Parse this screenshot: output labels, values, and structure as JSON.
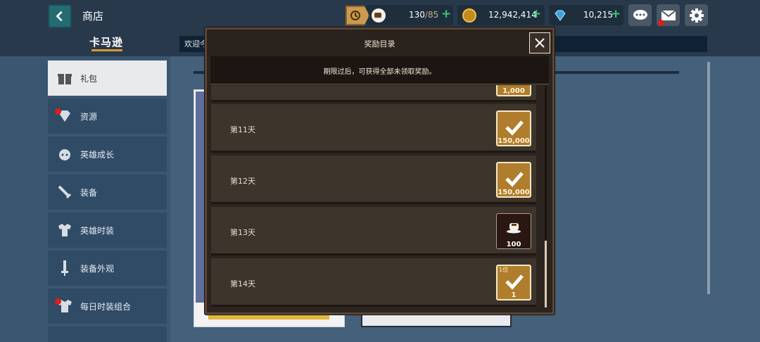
{
  "header": {
    "title": "商店",
    "brand": "卡马逊",
    "welcome": "欢迎今"
  },
  "resources": {
    "stamina": "130",
    "stamina_max": "/85",
    "gold": "12,942,414",
    "gems": "10,215"
  },
  "colors": {
    "accent_green": "#3cc67a",
    "gold_brown": "#b07d2c",
    "alert_red": "#e01c1c"
  },
  "sidebar": {
    "items": [
      {
        "label": "礼包",
        "icon": "gift-icon",
        "active": true
      },
      {
        "label": "资源",
        "icon": "diamond-icon",
        "badge": true
      },
      {
        "label": "英雄成长",
        "icon": "hero-growth-icon"
      },
      {
        "label": "装备",
        "icon": "sword-icon"
      },
      {
        "label": "英雄时装",
        "icon": "costume-icon"
      },
      {
        "label": "装备外观",
        "icon": "equipment-skin-icon"
      },
      {
        "label": "每日时装组合",
        "icon": "daily-costume-icon",
        "badge": true
      }
    ]
  },
  "modal": {
    "title": "奖励目录",
    "notice": "期限过后，可获得全部未领取奖励。",
    "rows": [
      {
        "day": "",
        "reward_qty": "1,000",
        "claimed": true
      },
      {
        "day": "第11天",
        "reward_qty": "150,000",
        "claimed": true
      },
      {
        "day": "第12天",
        "reward_qty": "150,000",
        "claimed": true
      },
      {
        "day": "第13天",
        "reward_qty": "100",
        "claimed": false,
        "reward_icon": "coffee-cup-icon"
      },
      {
        "day": "第14天",
        "reward_qty": "1",
        "claimed": true,
        "tag": "1倍"
      }
    ]
  }
}
